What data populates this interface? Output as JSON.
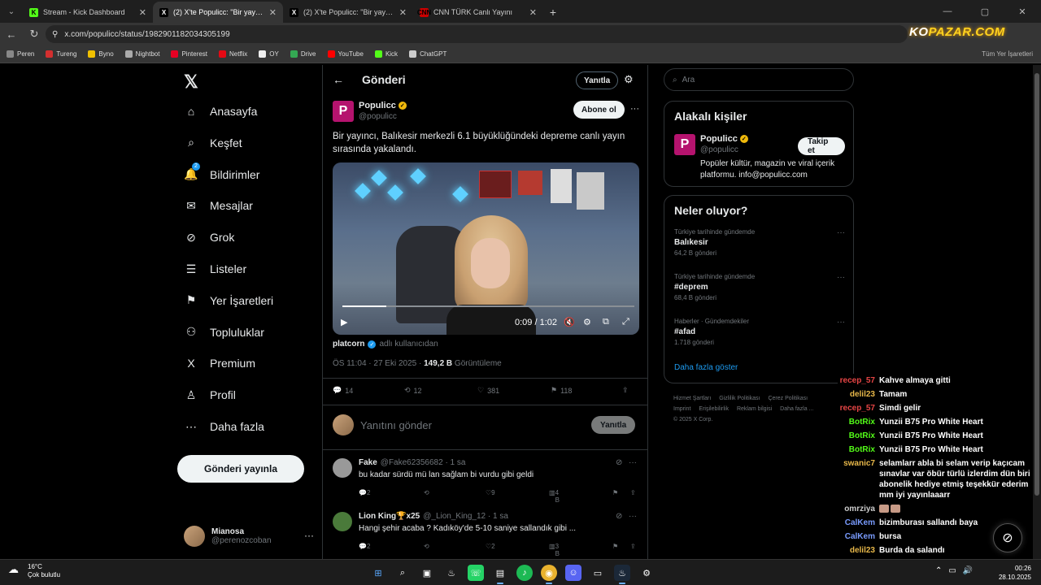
{
  "browser": {
    "tabs": [
      {
        "title": "Stream - Kick Dashboard",
        "fav": "K",
        "fav_color": "#53fc18"
      },
      {
        "title": "(2) X'te Populicc: \"Bir yayıncı, Ba",
        "fav": "X",
        "fav_color": "#000000"
      },
      {
        "title": "(2) X'te Populicc: \"Bir yayıncı, Ba",
        "fav": "X",
        "fav_color": "#000000"
      },
      {
        "title": "CNN TÜRK Canlı Yayını",
        "fav": "CNN",
        "fav_color": "#cc0000"
      }
    ],
    "new_tab": "+",
    "url": "x.com/populicc/status/1982901182034305199",
    "bookmarks": [
      {
        "label": "Peren",
        "color": "#888888"
      },
      {
        "label": "Tureng",
        "color": "#d32f2f"
      },
      {
        "label": "Byno",
        "color": "#f0c000"
      },
      {
        "label": "Nightbot",
        "color": "#aaaaaa"
      },
      {
        "label": "Pinterest",
        "color": "#e60023"
      },
      {
        "label": "Netflix",
        "color": "#e50914"
      },
      {
        "label": "OY",
        "color": "#eeeeee"
      },
      {
        "label": "Drive",
        "color": "#34a853"
      },
      {
        "label": "YouTube",
        "color": "#ff0000"
      },
      {
        "label": "Kick",
        "color": "#53fc18"
      },
      {
        "label": "ChatGPT",
        "color": "#cccccc"
      }
    ],
    "all_bookmarks": "Tüm Yer İşaretleri",
    "overlay_logo_a": "KO",
    "overlay_logo_b": "PAZAR.COM"
  },
  "nav": {
    "items": [
      {
        "label": "Anasayfa",
        "icon": "home-icon",
        "glyph": "⌂"
      },
      {
        "label": "Keşfet",
        "icon": "search-icon",
        "glyph": "⌕"
      },
      {
        "label": "Bildirimler",
        "icon": "bell-icon",
        "glyph": "🔔",
        "badge": "2"
      },
      {
        "label": "Mesajlar",
        "icon": "mail-icon",
        "glyph": "✉"
      },
      {
        "label": "Grok",
        "icon": "grok-icon",
        "glyph": "⊘"
      },
      {
        "label": "Listeler",
        "icon": "list-icon",
        "glyph": "☰"
      },
      {
        "label": "Yer İşaretleri",
        "icon": "bookmark-icon",
        "glyph": "⚑"
      },
      {
        "label": "Topluluklar",
        "icon": "people-icon",
        "glyph": "⚇"
      },
      {
        "label": "Premium",
        "icon": "x-icon",
        "glyph": "X"
      },
      {
        "label": "Profil",
        "icon": "person-icon",
        "glyph": "♙"
      },
      {
        "label": "Daha fazla",
        "icon": "more-circle-icon",
        "glyph": "⋯"
      }
    ],
    "post_button": "Gönderi yayınla",
    "account_name": "Mianosa",
    "account_handle": "@perenozcoban"
  },
  "post": {
    "header_title": "Gönderi",
    "replies_button": "Yanıtla",
    "author_name": "Populicc",
    "author_handle": "@populicc",
    "subscribe_button": "Abone ol",
    "text": "Bir yayıncı, Balıkesir merkezli 6.1 büyüklüğündeki depreme canlı yayın sırasında yakalandı.",
    "video_time": "0:09 / 1:02",
    "video_progress": 0.15,
    "credit_user": "platcorn",
    "credit_suffix": "adlı kullanıcıdan",
    "meta_time": "ÖS 11:04 · 27 Eki 2025 · ",
    "meta_views": "149,2 B",
    "meta_views_label": " Görüntüleme",
    "stats": {
      "replies": "14",
      "reposts": "12",
      "likes": "381",
      "bookmarks": "118"
    },
    "reply_placeholder": "Yanıtını gönder",
    "reply_button": "Yanıtla"
  },
  "comments": [
    {
      "name": "Fake",
      "handle": "@Fake62356682 · 1 sa",
      "text": "bu kadar sürdü mü lan sağlam bi vurdu gibi geldi",
      "replies": "2",
      "reposts": "",
      "likes": "9",
      "views": "4 B",
      "avatar_color": "#999999"
    },
    {
      "name": "Lion King🏆x25",
      "handle": "@_Lion_King_12 · 1 sa",
      "text": "Hangi şehir acaba ? Kadıköy'de 5-10 saniye sallandık gibi ...",
      "replies": "2",
      "reposts": "",
      "likes": "2",
      "views": "3 B",
      "avatar_color": "#4a7a3a"
    }
  ],
  "right": {
    "search_placeholder": "Ara",
    "related_title": "Alakalı kişiler",
    "related_name": "Populicc",
    "related_handle": "@populicc",
    "follow_button": "Takip et",
    "related_bio": "Popüler kültür, magazin ve viral içerik platformu. info@populicc.com",
    "whats_happening_title": "Neler oluyor?",
    "trends": [
      {
        "context": "Türkiye tarihinde gündemde",
        "title": "Balıkesir",
        "count": "64,2 B gönderi"
      },
      {
        "context": "Türkiye tarihinde gündemde",
        "title": "#deprem",
        "count": "68,4 B gönderi"
      },
      {
        "context": "Haberler · Gündemdekiler",
        "title": "#afad",
        "count": "1.718 gönderi"
      }
    ],
    "show_more": "Daha fazla göster",
    "footer_links": [
      "Hizmet Şartları",
      "Gizlilik Politikası",
      "Çerez Politikası",
      "Imprint",
      "Erişilebilirlik",
      "Reklam bilgisi",
      "Daha fazla ...",
      "© 2025 X Corp."
    ]
  },
  "chat": [
    {
      "user": "recep_57",
      "color": "#e64545",
      "msg": "Kahve almaya gitti"
    },
    {
      "user": "delil23",
      "color": "#e8b84a",
      "msg": "Tamam"
    },
    {
      "user": "recep_57",
      "color": "#e64545",
      "msg": "Simdi gelir"
    },
    {
      "user": "BotRix",
      "color": "#53fc18",
      "msg": "Yunzii B75 Pro White Heart"
    },
    {
      "user": "BotRix",
      "color": "#53fc18",
      "msg": "Yunzii B75 Pro White Heart"
    },
    {
      "user": "BotRix",
      "color": "#53fc18",
      "msg": "Yunzii B75 Pro White Heart"
    },
    {
      "user": "swanic7",
      "color": "#e8b84a",
      "msg": "selamlarr abla bi selam verip kaçıcam sınavlar var öbür türlü izlerdim dün biri abonelik hediye etmiş teşekkür ederim mm iyi yayınlaaarr"
    },
    {
      "user": "omrziya",
      "color": "#cccccc",
      "msg": ""
    },
    {
      "user": "CalKem",
      "color": "#7a9cff",
      "msg": "bizimburası sallandı baya"
    },
    {
      "user": "CalKem",
      "color": "#7a9cff",
      "msg": "bursa"
    },
    {
      "user": "delil23",
      "color": "#e8b84a",
      "msg": "Burda da salandı"
    }
  ],
  "taskbar": {
    "temp": "16°C",
    "weather": "Çok bulutlu",
    "time": "00:26",
    "date": "28.10.2025"
  }
}
